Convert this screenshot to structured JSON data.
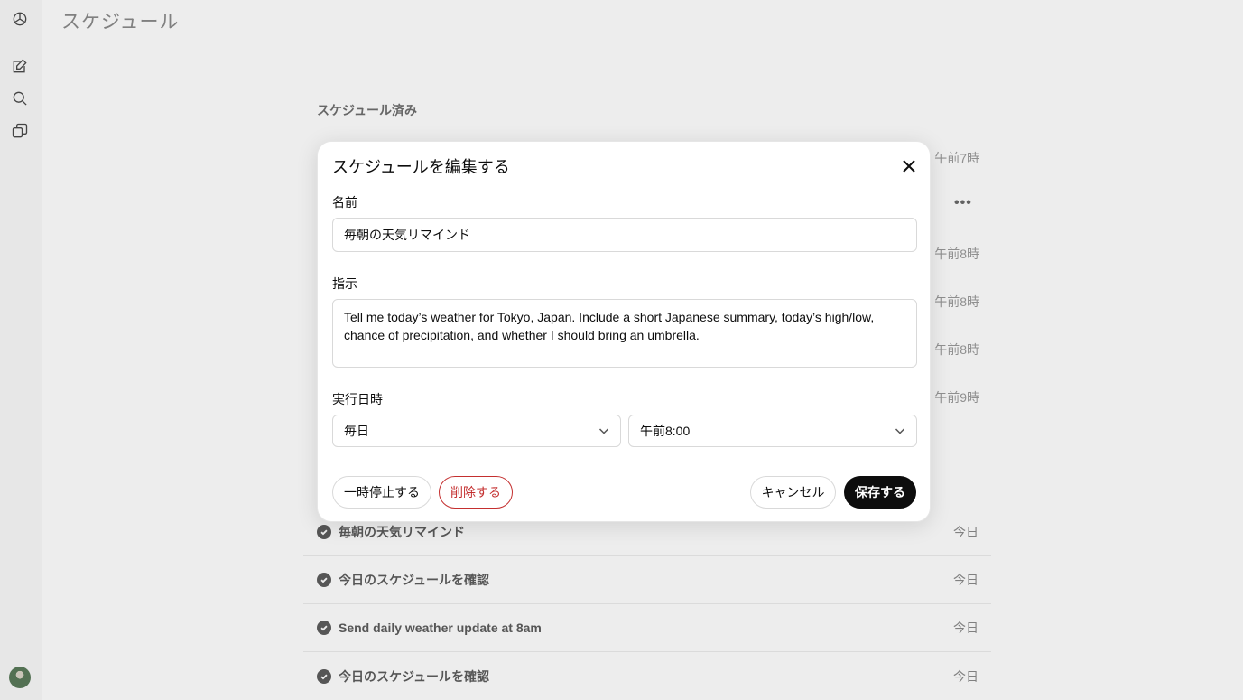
{
  "page": {
    "title": "スケジュール"
  },
  "section": {
    "scheduled_label": "スケジュール済み"
  },
  "sidebar": {
    "icons": [
      "openai-logo-icon",
      "new-chat-icon",
      "search-icon",
      "library-icon"
    ]
  },
  "background_times": [
    "午前7時",
    "午前8時",
    "午前8時",
    "午前8時",
    "午前9時"
  ],
  "completed_rows": [
    {
      "title": "毎朝の天気リマインド",
      "when": "今日"
    },
    {
      "title": "今日のスケジュールを確認",
      "when": "今日"
    },
    {
      "title": "Send daily weather update at 8am",
      "when": "今日"
    },
    {
      "title": "今日のスケジュールを確認",
      "when": "今日"
    }
  ],
  "modal": {
    "title": "スケジュールを編集する",
    "name_label": "名前",
    "name_value": "毎朝の天気リマインド",
    "instruction_label": "指示",
    "instruction_value": "Tell me today’s weather for Tokyo, Japan. Include a short Japanese summary, today’s high/low, chance of precipitation, and whether I should bring an umbrella.",
    "datetime_label": "実行日時",
    "frequency_value": "毎日",
    "time_value": "午前8:00",
    "pause_label": "一時停止する",
    "delete_label": "削除する",
    "cancel_label": "キャンセル",
    "save_label": "保存する"
  },
  "colors": {
    "danger": "#c42f2f",
    "primary": "#0d0d0d"
  }
}
